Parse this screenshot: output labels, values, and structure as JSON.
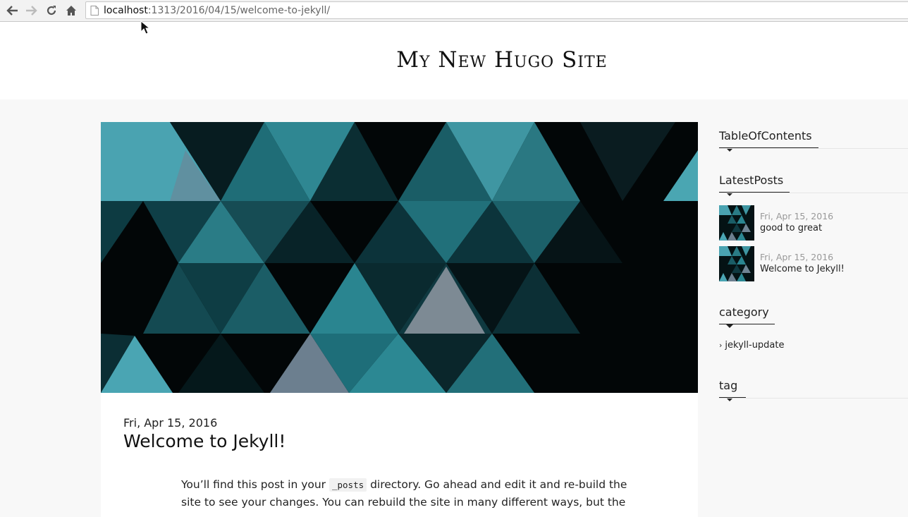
{
  "browser": {
    "url_host": "localhost",
    "url_path": ":1313/2016/04/15/welcome-to-jekyll/"
  },
  "site": {
    "title": "My New Hugo Site"
  },
  "post": {
    "date": "Fri, Apr 15, 2016",
    "title": "Welcome to Jekyll!",
    "body_before_code": "You’ll find this post in your ",
    "body_code": "_posts",
    "body_after_code": " directory. Go ahead and edit it and re-build the site to see your changes. You can rebuild the site in many different ways, but the"
  },
  "sidebar": {
    "toc_title": "TableOfContents",
    "latest_title": "LatestPosts",
    "latest_posts": [
      {
        "date": "Fri, Apr 15, 2016",
        "title": "good to great"
      },
      {
        "date": "Fri, Apr 15, 2016",
        "title": "Welcome to Jekyll!"
      }
    ],
    "category_title": "category",
    "categories": [
      "jekyll-update"
    ],
    "tag_title": "tag"
  },
  "colors": {
    "teal_light": "#4fa8b6",
    "teal_mid": "#2b7c86",
    "teal_dark": "#10444c",
    "gray_triangle": "#6f8494"
  }
}
